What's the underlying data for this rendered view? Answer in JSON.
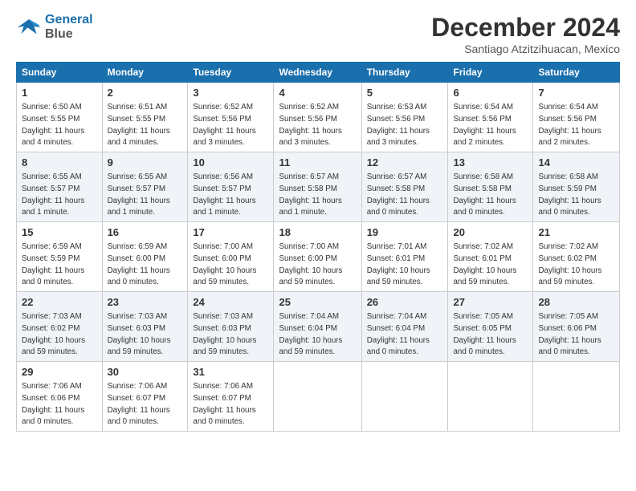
{
  "logo": {
    "line1": "General",
    "line2": "Blue"
  },
  "title": "December 2024",
  "location": "Santiago Atzitzihuacan, Mexico",
  "days_of_week": [
    "Sunday",
    "Monday",
    "Tuesday",
    "Wednesday",
    "Thursday",
    "Friday",
    "Saturday"
  ],
  "weeks": [
    [
      {
        "date": "1",
        "sunrise": "6:50 AM",
        "sunset": "5:55 PM",
        "daylight": "11 hours and 4 minutes."
      },
      {
        "date": "2",
        "sunrise": "6:51 AM",
        "sunset": "5:55 PM",
        "daylight": "11 hours and 4 minutes."
      },
      {
        "date": "3",
        "sunrise": "6:52 AM",
        "sunset": "5:56 PM",
        "daylight": "11 hours and 3 minutes."
      },
      {
        "date": "4",
        "sunrise": "6:52 AM",
        "sunset": "5:56 PM",
        "daylight": "11 hours and 3 minutes."
      },
      {
        "date": "5",
        "sunrise": "6:53 AM",
        "sunset": "5:56 PM",
        "daylight": "11 hours and 3 minutes."
      },
      {
        "date": "6",
        "sunrise": "6:54 AM",
        "sunset": "5:56 PM",
        "daylight": "11 hours and 2 minutes."
      },
      {
        "date": "7",
        "sunrise": "6:54 AM",
        "sunset": "5:56 PM",
        "daylight": "11 hours and 2 minutes."
      }
    ],
    [
      {
        "date": "8",
        "sunrise": "6:55 AM",
        "sunset": "5:57 PM",
        "daylight": "11 hours and 1 minute."
      },
      {
        "date": "9",
        "sunrise": "6:55 AM",
        "sunset": "5:57 PM",
        "daylight": "11 hours and 1 minute."
      },
      {
        "date": "10",
        "sunrise": "6:56 AM",
        "sunset": "5:57 PM",
        "daylight": "11 hours and 1 minute."
      },
      {
        "date": "11",
        "sunrise": "6:57 AM",
        "sunset": "5:58 PM",
        "daylight": "11 hours and 1 minute."
      },
      {
        "date": "12",
        "sunrise": "6:57 AM",
        "sunset": "5:58 PM",
        "daylight": "11 hours and 0 minutes."
      },
      {
        "date": "13",
        "sunrise": "6:58 AM",
        "sunset": "5:58 PM",
        "daylight": "11 hours and 0 minutes."
      },
      {
        "date": "14",
        "sunrise": "6:58 AM",
        "sunset": "5:59 PM",
        "daylight": "11 hours and 0 minutes."
      }
    ],
    [
      {
        "date": "15",
        "sunrise": "6:59 AM",
        "sunset": "5:59 PM",
        "daylight": "11 hours and 0 minutes."
      },
      {
        "date": "16",
        "sunrise": "6:59 AM",
        "sunset": "6:00 PM",
        "daylight": "11 hours and 0 minutes."
      },
      {
        "date": "17",
        "sunrise": "7:00 AM",
        "sunset": "6:00 PM",
        "daylight": "10 hours and 59 minutes."
      },
      {
        "date": "18",
        "sunrise": "7:00 AM",
        "sunset": "6:00 PM",
        "daylight": "10 hours and 59 minutes."
      },
      {
        "date": "19",
        "sunrise": "7:01 AM",
        "sunset": "6:01 PM",
        "daylight": "10 hours and 59 minutes."
      },
      {
        "date": "20",
        "sunrise": "7:02 AM",
        "sunset": "6:01 PM",
        "daylight": "10 hours and 59 minutes."
      },
      {
        "date": "21",
        "sunrise": "7:02 AM",
        "sunset": "6:02 PM",
        "daylight": "10 hours and 59 minutes."
      }
    ],
    [
      {
        "date": "22",
        "sunrise": "7:03 AM",
        "sunset": "6:02 PM",
        "daylight": "10 hours and 59 minutes."
      },
      {
        "date": "23",
        "sunrise": "7:03 AM",
        "sunset": "6:03 PM",
        "daylight": "10 hours and 59 minutes."
      },
      {
        "date": "24",
        "sunrise": "7:03 AM",
        "sunset": "6:03 PM",
        "daylight": "10 hours and 59 minutes."
      },
      {
        "date": "25",
        "sunrise": "7:04 AM",
        "sunset": "6:04 PM",
        "daylight": "10 hours and 59 minutes."
      },
      {
        "date": "26",
        "sunrise": "7:04 AM",
        "sunset": "6:04 PM",
        "daylight": "11 hours and 0 minutes."
      },
      {
        "date": "27",
        "sunrise": "7:05 AM",
        "sunset": "6:05 PM",
        "daylight": "11 hours and 0 minutes."
      },
      {
        "date": "28",
        "sunrise": "7:05 AM",
        "sunset": "6:06 PM",
        "daylight": "11 hours and 0 minutes."
      }
    ],
    [
      {
        "date": "29",
        "sunrise": "7:06 AM",
        "sunset": "6:06 PM",
        "daylight": "11 hours and 0 minutes."
      },
      {
        "date": "30",
        "sunrise": "7:06 AM",
        "sunset": "6:07 PM",
        "daylight": "11 hours and 0 minutes."
      },
      {
        "date": "31",
        "sunrise": "7:06 AM",
        "sunset": "6:07 PM",
        "daylight": "11 hours and 0 minutes."
      },
      null,
      null,
      null,
      null
    ]
  ]
}
